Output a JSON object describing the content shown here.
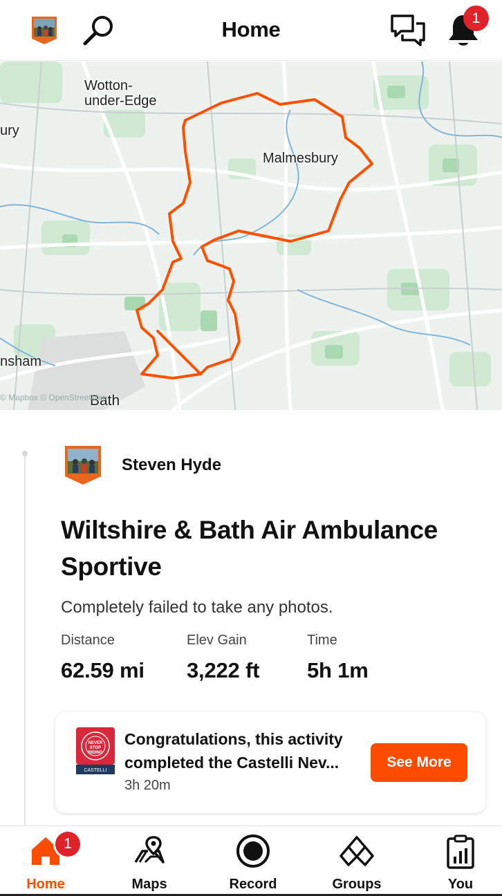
{
  "header": {
    "title": "Home",
    "notification_count": "1",
    "icons": [
      "club-avatar-icon",
      "search-icon",
      "chat-icon",
      "bell-icon"
    ]
  },
  "map": {
    "labels": {
      "wotton": "Wotton-\nunder-Edge",
      "malmesbury": "Malmesbury",
      "bath": "Bath",
      "left_top": "ury",
      "left_bottom": "nsham"
    },
    "attribution": "© Mapbox © OpenStreetMap",
    "route_color": "#fc5200"
  },
  "activity": {
    "athlete_name": "Steven Hyde",
    "title": "Wiltshire & Bath Air Ambulance Sportive",
    "description": "Completely failed to take any photos.",
    "stats": [
      {
        "label": "Distance",
        "value": "62.59 mi"
      },
      {
        "label": "Elev Gain",
        "value": "3,222 ft"
      },
      {
        "label": "Time",
        "value": "5h 1m"
      }
    ]
  },
  "achievement": {
    "message_line1": "Congratulations, this activity",
    "message_line2": "completed the Castelli Nev...",
    "time": "3h 20m",
    "button_label": "See More",
    "badge_text": "NEVER STOP RIDING",
    "brand": "CASTELLI"
  },
  "bottom_nav": {
    "items": [
      {
        "label": "Home",
        "icon": "home-icon",
        "active": true
      },
      {
        "label": "Maps",
        "icon": "maps-icon",
        "active": false
      },
      {
        "label": "Record",
        "icon": "record-icon",
        "active": false
      },
      {
        "label": "Groups",
        "icon": "groups-icon",
        "active": false
      },
      {
        "label": "You",
        "icon": "you-icon",
        "active": false
      }
    ],
    "home_badge": "1"
  },
  "colors": {
    "accent": "#fc4c02",
    "badge_red": "#e0222b"
  }
}
